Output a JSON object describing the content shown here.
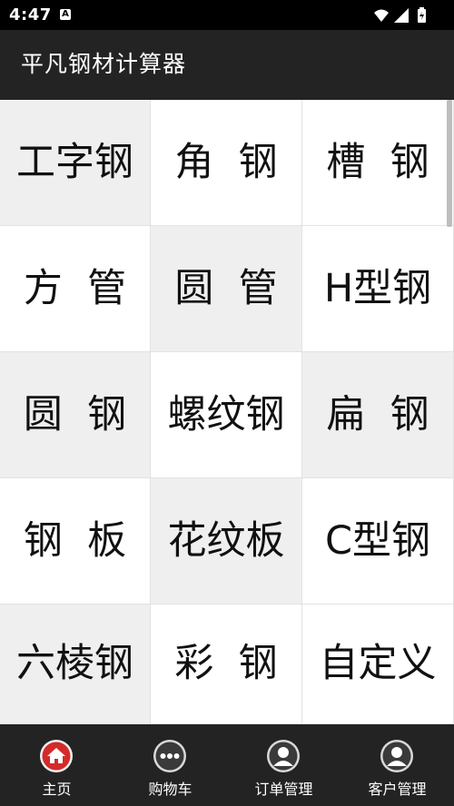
{
  "status": {
    "time": "4:47",
    "notif_icon": "A"
  },
  "header": {
    "title": "平凡钢材计算器"
  },
  "grid": {
    "cells": [
      {
        "label": "工字钢",
        "bg": "gray"
      },
      {
        "label": "角  钢",
        "bg": "white"
      },
      {
        "label": "槽  钢",
        "bg": "white"
      },
      {
        "label": "方  管",
        "bg": "white"
      },
      {
        "label": "圆  管",
        "bg": "gray"
      },
      {
        "label": "H型钢",
        "bg": "white"
      },
      {
        "label": "圆  钢",
        "bg": "gray"
      },
      {
        "label": "螺纹钢",
        "bg": "white"
      },
      {
        "label": "扁  钢",
        "bg": "gray"
      },
      {
        "label": "钢  板",
        "bg": "white"
      },
      {
        "label": "花纹板",
        "bg": "gray"
      },
      {
        "label": "C型钢",
        "bg": "white"
      },
      {
        "label": "六棱钢",
        "bg": "gray"
      },
      {
        "label": "彩  钢",
        "bg": "white"
      },
      {
        "label": "自定义",
        "bg": "white"
      }
    ]
  },
  "bottom_nav": {
    "items": [
      {
        "label": "主页",
        "icon": "home-icon"
      },
      {
        "label": "购物车",
        "icon": "more-dots-icon"
      },
      {
        "label": "订单管理",
        "icon": "user-icon"
      },
      {
        "label": "客户管理",
        "icon": "user-icon"
      }
    ]
  },
  "colors": {
    "app_bar": "#232323",
    "nav_bar": "#232323",
    "home_icon_red": "#d42a2a",
    "cell_gray": "#efefef",
    "cell_white": "#ffffff"
  }
}
